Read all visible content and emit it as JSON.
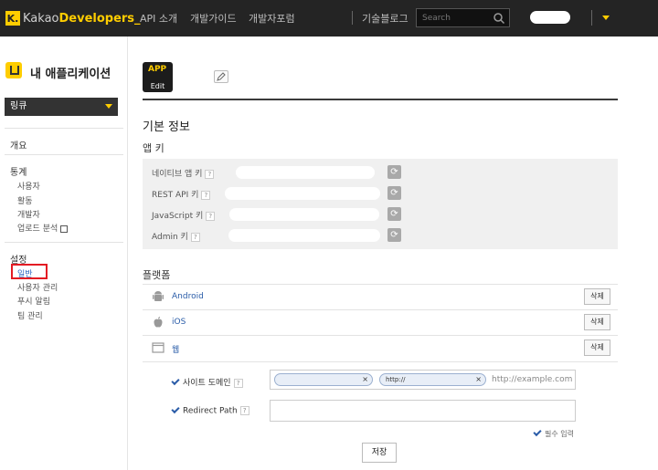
{
  "topbar": {
    "logo_k": "K.",
    "logo_kakao": "Kakao",
    "logo_dev": "Developers_",
    "nav": [
      "API 소개",
      "개발가이드",
      "개발자포럼",
      "기술블로그"
    ],
    "search_placeholder": "Search"
  },
  "sidebar": {
    "app_title": "내 애플리케이션",
    "app_select": "링큐",
    "overview": "개요",
    "stats_head": "통계",
    "stats_items": [
      "사용자",
      "활동",
      "개발자",
      "업로드 분석"
    ],
    "settings_head": "설정",
    "settings_items": [
      "일반",
      "사용자 관리",
      "푸시 알림",
      "팀 관리"
    ]
  },
  "main": {
    "icon_app": "APP",
    "icon_edit": "Edit",
    "basic_title": "기본 정보",
    "appkey_title": "앱 키",
    "keys": [
      {
        "label": "네이티브 앱 키"
      },
      {
        "label": "REST API 키"
      },
      {
        "label": "JavaScript 키"
      },
      {
        "label": "Admin 키"
      }
    ],
    "help_glyph": "?",
    "platform_title": "플랫폼",
    "platforms": [
      {
        "name": "Android",
        "icon": "android-icon"
      },
      {
        "name": "iOS",
        "icon": "apple-icon"
      },
      {
        "name": "웹",
        "icon": "web-icon"
      }
    ],
    "delete_label": "삭제",
    "site_domain_label": "사이트 도메인",
    "domain_tags": [
      "",
      "http://"
    ],
    "domain_placeholder": "http://example.com",
    "redirect_label": "Redirect Path",
    "required_note": "필수 입력",
    "save_label": "저장"
  }
}
